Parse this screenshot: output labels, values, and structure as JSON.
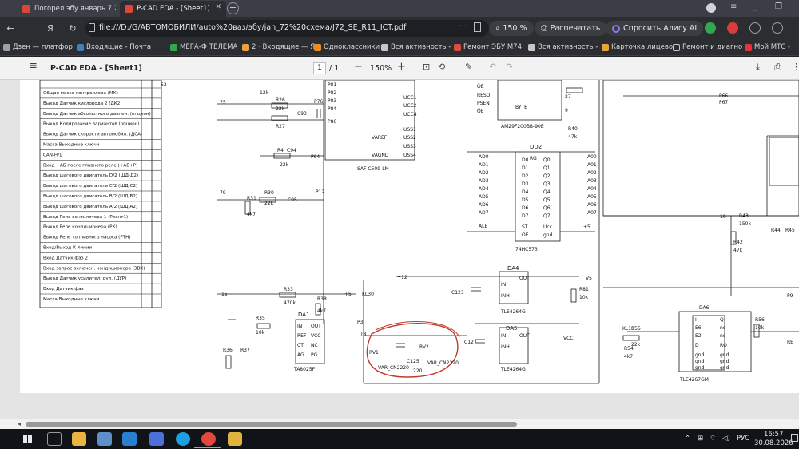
{
  "tabs": [
    {
      "label": "Погорел эбу январь 7.2 н",
      "active": false
    },
    {
      "label": "P-CAD EDA - [Sheet1]",
      "active": true
    }
  ],
  "url": "file:///D:/G/АВТОМОБИЛИ/auto%20ваз/эбу/jan_72%20схема/J72_SE_R11_ICT.pdf",
  "zoom_browser": "150 %",
  "print_label": "Распечатать",
  "alice_label": "Спросить Алису AI",
  "bookmarks": [
    "Дзен — платфор",
    "Входящие - Почта",
    "МЕГА-Ф ТЕЛЕМА",
    "2 · Входящие — Я",
    "Одноклассники",
    "Вся активность -",
    "Ремонт ЭБУ M74",
    "Вся активность -",
    "Карточка лицево",
    "Ремонт и диагно",
    "Мой МТС -"
  ],
  "pdf": {
    "title": "P-CAD EDA - [Sheet1]",
    "page_current": "1",
    "page_total": "/ 1",
    "zoom": "150%"
  },
  "left_table": [
    "Общая масса контроллера (МК)",
    "Выход Датчик кислорода 2 (ДК2)",
    "Выход Датчик абсолютного давлен. (опцион)",
    "Выход Кодирование вариантов (опцион)",
    "Выход Датчик скорости автомобил. (ДСА)",
    "Масса Выходные ключи",
    "CAN-H/1",
    "Вход +АБ после главного реле (+АБ+Р)",
    "Выход шагового двигатель D/2 (ШД-Д2)",
    "Выход шагового двигатель C/2 (ШД-С2)",
    "Выход шагового двигатель B/2 (ШД-В2)",
    "Выход шагового двигатель A/2 (ШД-А2)",
    "Выход Реле вентилятора 1 (Рвент1)",
    "Выход Реле кондиционера (РК)",
    "Выход Реле топливного насоса (РТН)",
    "Вход/Выход К-линии",
    "Вход Датчик фаз 2",
    "Вход запрос включен. кондиционера (ЗВК)",
    "Выход Датчик усилител. рул. (ДУР)",
    "Вход Датчик фаз",
    "Масса Выходные ключи"
  ],
  "chips": {
    "dd2": "DD2",
    "dd2_part": "74HC573",
    "da4": "DA4",
    "da4_part": "TLE4264G",
    "da5": "DA5",
    "da5_part": "TLE4264G",
    "da1": "DA1",
    "da1_part": "TA8025F",
    "da6": "DA6",
    "da6_part": "TLE4267GM",
    "mcu_part": "SAF C509-LM",
    "flash_part": "AM29F200BB-90E"
  },
  "taskbar": {
    "lang": "РУС",
    "time": "16:57",
    "date": "30.08.2026"
  },
  "colors": {
    "annotation": "#c0392b",
    "active_tab": "#2b2d31"
  }
}
